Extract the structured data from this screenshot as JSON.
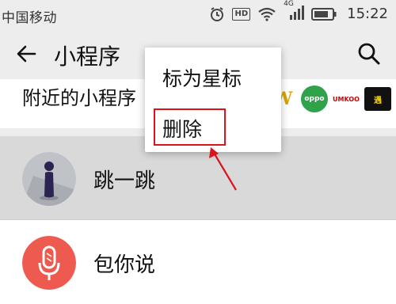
{
  "status_bar": {
    "carrier": "中国移动",
    "network": "4G",
    "hd": "HD",
    "time": "15:22"
  },
  "header": {
    "title": "小程序",
    "back_icon": "arrow-left-icon",
    "search_icon": "search-icon"
  },
  "nearby": {
    "label": "附近的小程序",
    "logos": [
      "W",
      "oppo",
      "UMKOO",
      "遇"
    ]
  },
  "apps": [
    {
      "name": "跳一跳",
      "icon": "jump-jump-icon",
      "color": "#2b2350"
    },
    {
      "name": "包你说",
      "icon": "microphone-icon",
      "color": "#ee5a4f"
    }
  ],
  "context_menu": {
    "items": [
      "标为星标",
      "删除"
    ]
  },
  "colors": {
    "header_bg": "#ededed",
    "highlight_red": "#d9151b",
    "selected_row": "#d9d9d9"
  }
}
